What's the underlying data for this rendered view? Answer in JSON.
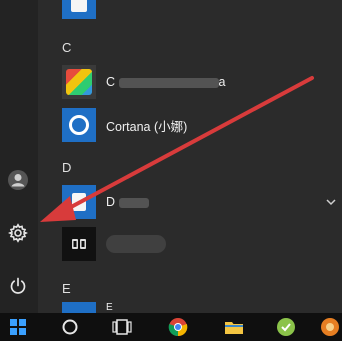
{
  "start_menu": {
    "sections": [
      {
        "letter": "C",
        "apps": [
          {
            "label": "C",
            "label_suffix": "a",
            "icon": "tiles-photo-icon",
            "blurred": true
          },
          {
            "label": "Cortana (小娜)",
            "icon": "cortana-ring-icon",
            "blurred": false
          }
        ]
      },
      {
        "letter": "D",
        "apps": [
          {
            "label": "D",
            "icon": "blue-tile-icon",
            "blurred": true,
            "expandable": true
          },
          {
            "label": "",
            "icon": "dolby-icon",
            "blurred": true
          }
        ]
      },
      {
        "letter": "E",
        "apps": [
          {
            "label": "E",
            "icon": "blue-tile-icon",
            "blurred": true
          }
        ]
      }
    ]
  },
  "left_rail": {
    "items": [
      {
        "name": "user-account-icon"
      },
      {
        "name": "settings-gear-icon"
      },
      {
        "name": "power-icon"
      }
    ]
  },
  "taskbar": {
    "items": [
      {
        "name": "windows-start-icon"
      },
      {
        "name": "cortana-search-icon"
      },
      {
        "name": "task-view-icon"
      },
      {
        "name": "chrome-icon"
      },
      {
        "name": "file-explorer-icon"
      },
      {
        "name": "app-green-icon"
      },
      {
        "name": "app-orange-icon"
      }
    ]
  },
  "colors": {
    "accent_blue": "#1f6fc5",
    "annotation_arrow": "#d83b3b",
    "menu_bg": "#2b2b2b",
    "taskbar_bg": "#0f0f0f"
  }
}
